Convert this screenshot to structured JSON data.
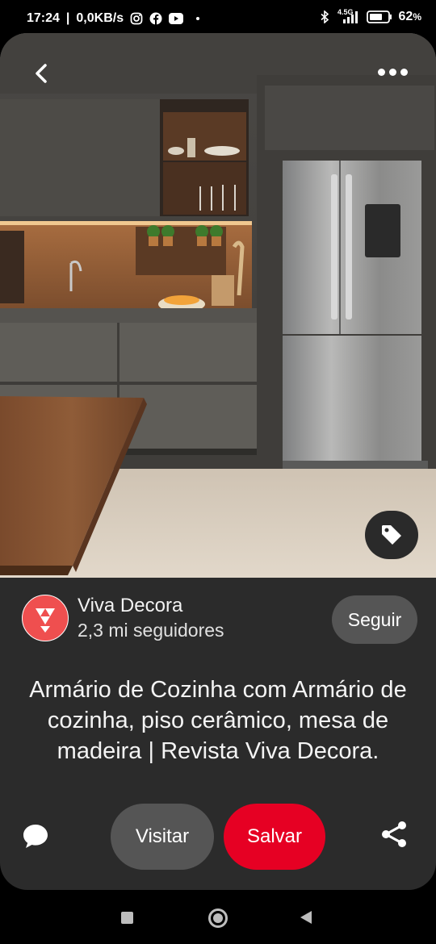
{
  "status_bar": {
    "time": "17:24",
    "speed": "0,0KB/s",
    "network": "4.5G",
    "battery_percent": "62",
    "battery_suffix": "%",
    "icons": [
      "instagram-icon",
      "facebook-icon",
      "youtube-icon",
      "dot-icon",
      "bluetooth-icon",
      "signal-icon",
      "battery-icon"
    ]
  },
  "pin": {
    "image_subject": "kitchen-photo",
    "icons": {
      "back": "chevron-left-icon",
      "more": "more-dots-icon",
      "tag": "tag-icon"
    }
  },
  "profile": {
    "name": "Viva Decora",
    "followers": "2,3 mi seguidores",
    "follow_label": "Seguir",
    "avatar_color": "#ef4f4f"
  },
  "title": "Armário de Cozinha com Armário de cozinha, piso cerâmico, mesa de madeira | Revista Viva Decora.",
  "actions": {
    "visit_label": "Visitar",
    "save_label": "Salvar",
    "save_color": "#e60023",
    "icons": {
      "comment": "comment-icon",
      "share": "share-icon"
    }
  },
  "nav": {
    "icons": [
      "recents-icon",
      "home-icon",
      "back-icon"
    ]
  }
}
